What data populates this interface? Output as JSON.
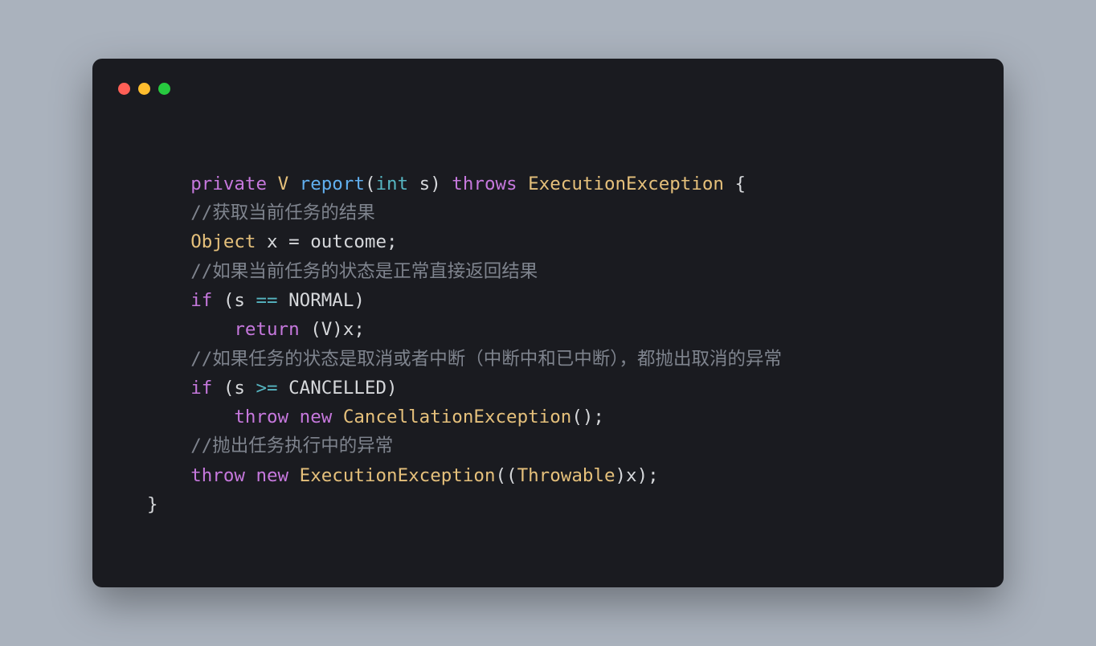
{
  "window": {
    "title_bar": {
      "close": "close",
      "minimize": "minimize",
      "maximize": "maximize"
    }
  },
  "code": {
    "t1_priv": "private",
    "t1_V": "V",
    "t1_fn": "report",
    "t1_lp": "(",
    "t1_int": "int",
    "t1_s": " s",
    "t1_rp": ")",
    "t1_throws": " throws ",
    "t1_ex": "ExecutionException",
    "t1_ob": " {",
    "c1": "//获取当前任务的结果",
    "t2_obj": "Object",
    "t2_rest": " x = outcome;",
    "c2": "//如果当前任务的状态是正常直接返回结果",
    "t3_if": "if",
    "t3_lp": " (s ",
    "t3_op": "==",
    "t3_rest": " NORMAL)",
    "t4_ret": "return",
    "t4_rest": " (V)x;",
    "c3": "//如果任务的状态是取消或者中断（中断中和已中断），都抛出取消的异常",
    "t5_if": "if",
    "t5_lp": " (s ",
    "t5_op": ">=",
    "t5_rest": " CANCELLED)",
    "t6_throw": "throw",
    "t6_new": " new ",
    "t6_cls": "CancellationException",
    "t6_rest": "();",
    "c4": "//抛出任务执行中的异常",
    "t7_throw": "throw",
    "t7_new": " new ",
    "t7_cls": "ExecutionException",
    "t7_lp": "((",
    "t7_thr": "Throwable",
    "t7_rest": ")x);",
    "t8_cb": "}"
  }
}
